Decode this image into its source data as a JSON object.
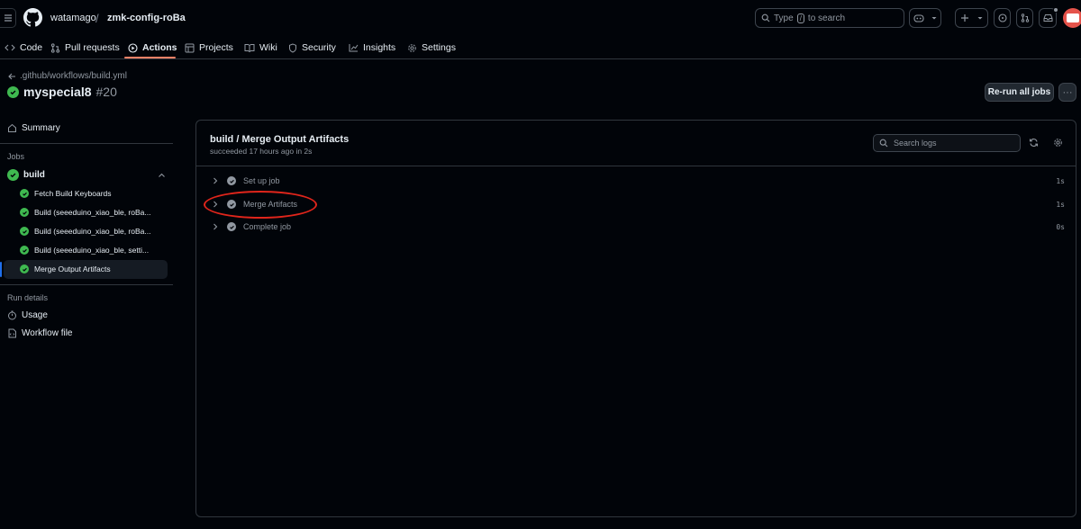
{
  "header": {
    "owner": "watamago",
    "separator": "/",
    "repo": "zmk-config-roBa",
    "search_text": "Type",
    "search_key": "/",
    "search_suffix": "to search"
  },
  "nav": {
    "tabs": [
      {
        "label": "Code",
        "icon": "code-icon"
      },
      {
        "label": "Pull requests",
        "icon": "git-pull-request-icon"
      },
      {
        "label": "Actions",
        "icon": "play-icon",
        "active": true
      },
      {
        "label": "Projects",
        "icon": "table-icon"
      },
      {
        "label": "Wiki",
        "icon": "book-icon"
      },
      {
        "label": "Security",
        "icon": "shield-icon"
      },
      {
        "label": "Insights",
        "icon": "graph-icon"
      },
      {
        "label": "Settings",
        "icon": "gear-icon"
      }
    ]
  },
  "run": {
    "back_path": ".github/workflows/build.yml",
    "name": "myspecial8",
    "number": "#20",
    "rerun_label": "Re-run all jobs",
    "more_label": "···"
  },
  "sidebar": {
    "summary": "Summary",
    "jobs_heading": "Jobs",
    "job_group": "build",
    "jobs": [
      "Fetch Build Keyboards",
      "Build (seeeduino_xiao_ble, roBa...",
      "Build (seeeduino_xiao_ble, roBa...",
      "Build (seeeduino_xiao_ble, setti...",
      "Merge Output Artifacts"
    ],
    "run_details_heading": "Run details",
    "usage": "Usage",
    "workflow_file": "Workflow file"
  },
  "job": {
    "title": "build / Merge Output Artifacts",
    "subtitle": "succeeded 17 hours ago in 2s",
    "search_placeholder": "Search logs",
    "steps": [
      {
        "name": "Set up job",
        "duration": "1s"
      },
      {
        "name": "Merge Artifacts",
        "duration": "1s"
      },
      {
        "name": "Complete job",
        "duration": "0s"
      }
    ]
  },
  "colors": {
    "success": "#3fb950",
    "annotation": "#e0251b",
    "active_tab_underline": "#f78166"
  }
}
